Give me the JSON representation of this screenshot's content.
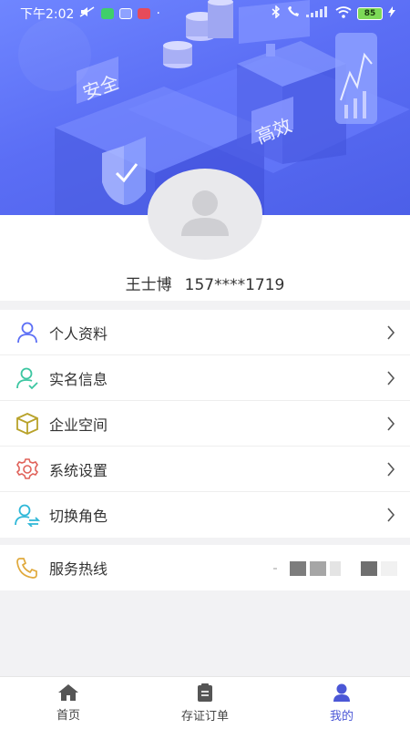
{
  "status_bar": {
    "time": "下午2:02",
    "dot": "·",
    "battery": "85"
  },
  "hero": {
    "badges": [
      "安全",
      "高效"
    ]
  },
  "user": {
    "name": "王士博",
    "phone": "157****1719"
  },
  "menu": [
    {
      "label": "个人资料",
      "icon": "user-icon",
      "color": "#5b6ef5"
    },
    {
      "label": "实名信息",
      "icon": "user-check-icon",
      "color": "#3cc6a1"
    },
    {
      "label": "企业空间",
      "icon": "box-icon",
      "color": "#b8a22a"
    },
    {
      "label": "系统设置",
      "icon": "gear-icon",
      "color": "#e0625a"
    },
    {
      "label": "切换角色",
      "icon": "user-switch-icon",
      "color": "#2fb8d8"
    }
  ],
  "hotline": {
    "label": "服务热线",
    "icon": "phone-icon",
    "color": "#e0a93c"
  },
  "tabs": [
    {
      "label": "首页",
      "icon": "home-icon"
    },
    {
      "label": "存证订单",
      "icon": "clipboard-icon"
    },
    {
      "label": "我的",
      "icon": "person-icon",
      "active": true
    }
  ],
  "colors": {
    "accent": "#4b57d6",
    "hero": "#5b6ef5"
  }
}
